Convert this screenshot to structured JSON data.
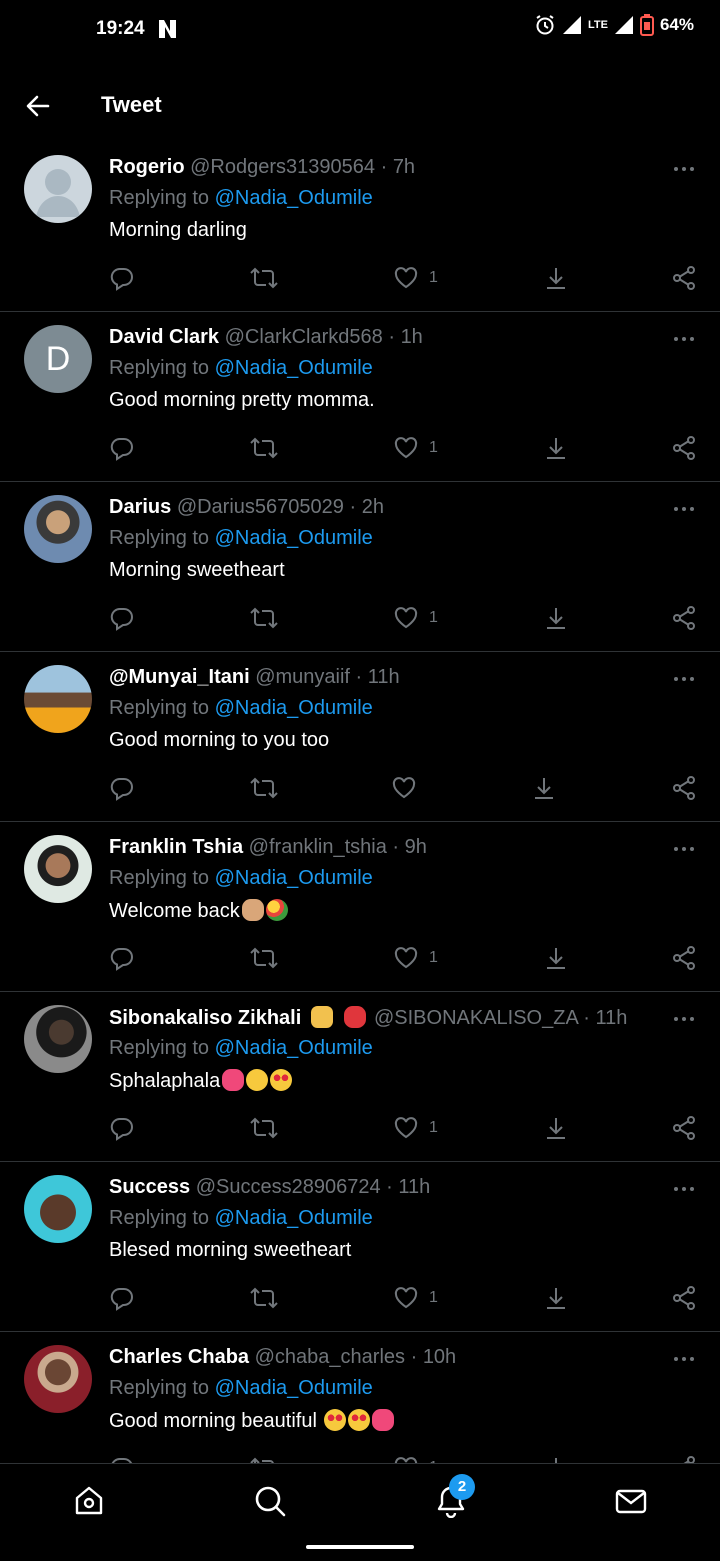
{
  "status_bar": {
    "time": "19:24",
    "network": "LTE",
    "battery": "64%"
  },
  "header": {
    "title": "Tweet"
  },
  "colors": {
    "background": "#000000",
    "accent": "#1d9bf0",
    "muted": "#71767b",
    "divider": "#2f3336"
  },
  "replies": [
    {
      "name": "Rogerio",
      "handle": "@Rodgers31390564",
      "sep": "·",
      "age": "7h",
      "replying_label": "Replying to",
      "mention": "@Nadia_Odumile",
      "text": "Morning darling",
      "likes": "1",
      "avatar": "default-avatar-icon"
    },
    {
      "name": "David Clark",
      "handle": "@ClarkClarkd568",
      "sep": "·",
      "age": "1h",
      "replying_label": "Replying to",
      "mention": "@Nadia_Odumile",
      "text": "Good morning pretty momma.",
      "likes": "1",
      "avatar_letter": "D"
    },
    {
      "name": "Darius",
      "handle": "@Darius56705029",
      "sep": "·",
      "age": "2h",
      "replying_label": "Replying to",
      "mention": "@Nadia_Odumile",
      "text": "Morning sweetheart",
      "likes": "1",
      "avatar": "photo"
    },
    {
      "name": "@Munyai_Itani",
      "handle": "@munyaiif",
      "sep": "·",
      "age": "11h",
      "replying_label": "Replying to",
      "mention": "@Nadia_Odumile",
      "text": "Good morning to you too",
      "likes": "",
      "avatar": "photo"
    },
    {
      "name": "Franklin Tshia",
      "handle": "@franklin_tshia",
      "sep": "·",
      "age": "9h",
      "replying_label": "Replying to",
      "mention": "@Nadia_Odumile",
      "text": "Welcome back",
      "likes": "1",
      "emojis": [
        "clapping-hands-emoji",
        "bouquet-emoji"
      ],
      "avatar": "photo"
    },
    {
      "name": "Sibonakaliso Zikhali",
      "handle": "@SIBONAKALISO_ZA",
      "sep": "·",
      "age": "11h",
      "replying_label": "Replying to",
      "mention": "@Nadia_Odumile",
      "text": "Sphalaphala",
      "likes": "1",
      "emojis": [
        "growing-heart-emoji",
        "relieved-face-emoji",
        "heart-eyes-emoji"
      ],
      "name_emojis": [
        "writing-hand-emoji",
        "bird-emoji"
      ],
      "avatar": "photo"
    },
    {
      "name": "Success",
      "handle": "@Success28906724",
      "sep": "·",
      "age": "11h",
      "replying_label": "Replying to",
      "mention": "@Nadia_Odumile",
      "text": "Blesed morning sweetheart",
      "likes": "1",
      "avatar": "photo"
    },
    {
      "name": "Charles Chaba",
      "handle": "@chaba_charles",
      "sep": "·",
      "age": "10h",
      "replying_label": "Replying to",
      "mention": "@Nadia_Odumile",
      "text": "Good morning beautiful",
      "likes": "1",
      "emojis": [
        "heart-eyes-emoji",
        "heart-eyes-emoji",
        "two-hearts-emoji"
      ],
      "avatar": "photo"
    }
  ],
  "bottom_nav": {
    "items": [
      "home-icon",
      "search-icon",
      "notifications-icon",
      "messages-icon"
    ],
    "notification_count": "2"
  }
}
